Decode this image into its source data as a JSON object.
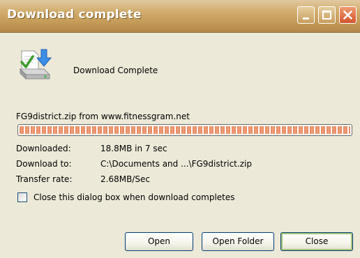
{
  "window": {
    "title": "Download complete"
  },
  "header": {
    "status_label": "Download Complete",
    "icon": "download-disk-icon"
  },
  "file_source": "FG9district.zip from www.fitnessgram.net",
  "progress": {
    "fraction": 1.0,
    "color": "#e4825a"
  },
  "details": [
    {
      "key": "Downloaded:",
      "value": "18.8MB in 7 sec"
    },
    {
      "key": "Download to:",
      "value": "C:\\Documents and ...\\FG9district.zip"
    },
    {
      "key": "Transfer rate:",
      "value": "2.68MB/Sec"
    }
  ],
  "close_when_complete": {
    "label": "Close this dialog box when download completes",
    "checked": false
  },
  "buttons": {
    "open": "Open",
    "open_folder": "Open Folder",
    "close": "Close"
  },
  "colors": {
    "titlebar": "#c49a57",
    "dialog_bg": "#ece9d8",
    "close_button": "#d4532b"
  }
}
